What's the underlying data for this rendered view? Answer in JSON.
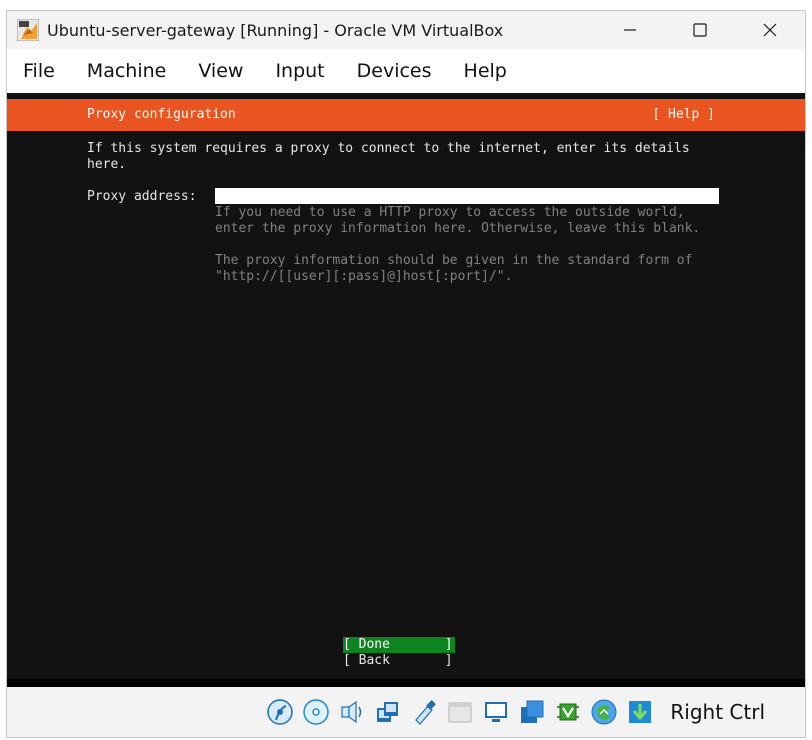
{
  "window": {
    "title": "Ubuntu-server-gateway [Running] - Oracle VM VirtualBox",
    "controls": {
      "minimize": "—",
      "maximize": "☐",
      "close": "✕"
    }
  },
  "menu": {
    "items": [
      "File",
      "Machine",
      "View",
      "Input",
      "Devices",
      "Help"
    ]
  },
  "installer": {
    "header_title": "Proxy configuration",
    "header_help": "[ Help ]",
    "intro": "If this system requires a proxy to connect to the internet, enter its details\nhere.",
    "proxy_label": "Proxy address:",
    "proxy_value": "",
    "help_text_1": "If you need to use a HTTP proxy to access the outside world,\nenter the proxy information here. Otherwise, leave this blank.",
    "help_text_2": "The proxy information should be given in the standard form of\n\"http://[[user][:pass]@]host[:port]/\".",
    "done_button": "[ Done       ]",
    "back_button": "[ Back       ]"
  },
  "statusbar": {
    "icons": [
      "hard-disk-icon",
      "optical-drive-icon",
      "audio-icon",
      "network-icon",
      "usb-icon",
      "shared-folders-icon",
      "display-icon",
      "recording-icon",
      "cpu-virtualization-icon",
      "guest-additions-icon",
      "mouse-integration-icon"
    ],
    "host_key": "Right Ctrl"
  },
  "colors": {
    "ubuntu_orange": "#e95420",
    "done_green": "#0e8420",
    "vm_background": "#121212"
  }
}
